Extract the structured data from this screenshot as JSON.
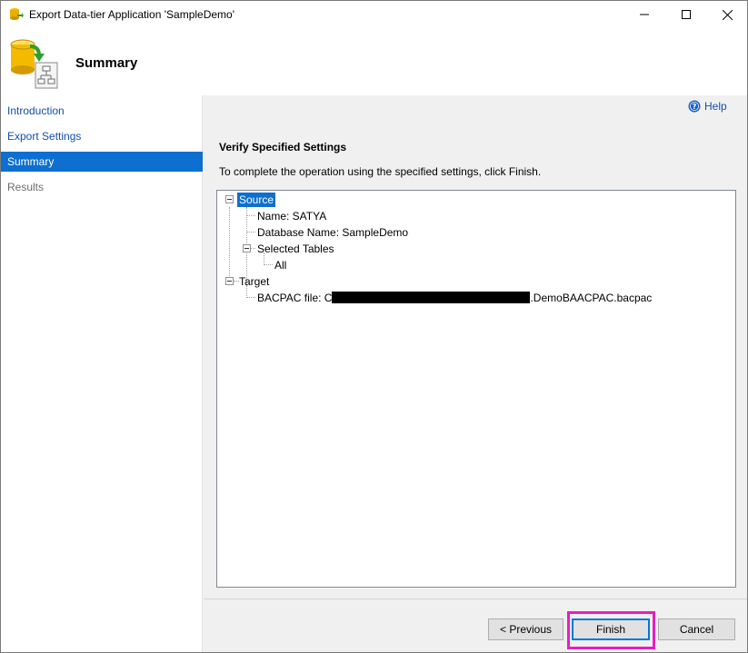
{
  "window": {
    "title": "Export Data-tier Application 'SampleDemo'",
    "minimize_glyph": "—",
    "maximize_glyph": "☐",
    "close_glyph": "✕"
  },
  "header": {
    "title": "Summary",
    "icon": "database-export-icon"
  },
  "nav": {
    "items": [
      {
        "label": "Introduction",
        "state": "link"
      },
      {
        "label": "Export Settings",
        "state": "link"
      },
      {
        "label": "Summary",
        "state": "active"
      },
      {
        "label": "Results",
        "state": "disabled"
      }
    ]
  },
  "content": {
    "help_label": "Help",
    "section_title": "Verify Specified Settings",
    "instructions": "To complete the operation using the specified settings, click Finish.",
    "tree": {
      "source_label": "Source",
      "name": "Name: SATYA",
      "database_name": "Database Name: SampleDemo",
      "selected_tables": "Selected Tables",
      "all": "All",
      "target_label": "Target",
      "bacpac_prefix": "BACPAC file: C",
      "bacpac_suffix": ".DemoBAACPAC.bacpac"
    }
  },
  "footer": {
    "previous_label": "< Previous",
    "finish_label": "Finish",
    "cancel_label": "Cancel"
  },
  "colors": {
    "accent": "#0d6fd0",
    "link": "#0f4fae",
    "highlight": "#e61fbf"
  }
}
